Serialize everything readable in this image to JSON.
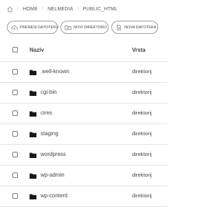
{
  "breadcrumb": {
    "items": [
      "HOME",
      "NELMEDIA",
      "PUBLIC_HTML"
    ],
    "separator": "/"
  },
  "toolbar": {
    "upload_label": "PRENESI DATOTEKU",
    "new_dir_label": "NOVI DIREKTORIJ",
    "new_file_label": "NOVA DATOTEKA"
  },
  "table": {
    "headers": {
      "name": "Naziv",
      "type": "Vrsta"
    },
    "rows": [
      {
        "name": ".well-known",
        "type": "direktorij"
      },
      {
        "name": "cgi-bin",
        "type": "direktorij"
      },
      {
        "name": "cires",
        "type": "direktorij"
      },
      {
        "name": "staging",
        "type": "direktorij"
      },
      {
        "name": "wordpress",
        "type": "direktorij"
      },
      {
        "name": "wp-admin",
        "type": "direktorij"
      },
      {
        "name": "wp-content",
        "type": "direktorij"
      }
    ]
  },
  "icons": {
    "home": "home-icon",
    "upload": "cloud-upload-icon",
    "new_dir": "folder-plus-icon",
    "new_file": "file-plus-icon",
    "folder": "folder-icon"
  }
}
